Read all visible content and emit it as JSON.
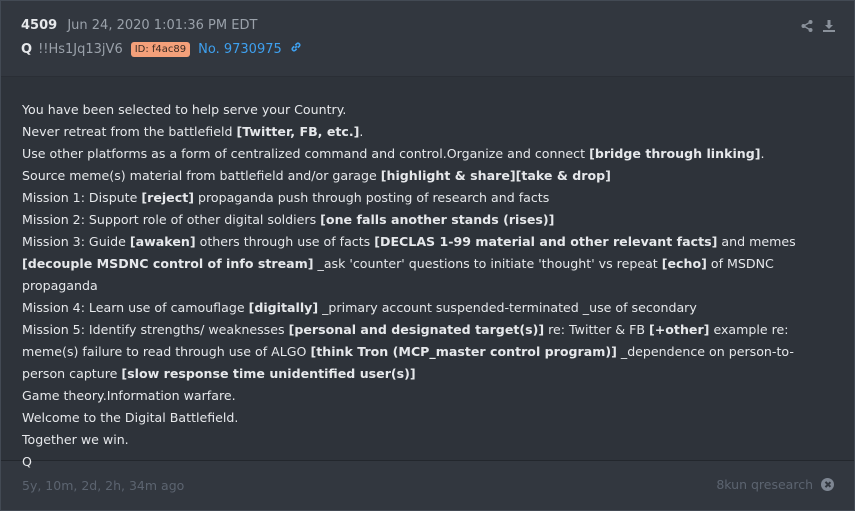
{
  "post": {
    "number": "4509",
    "date": "Jun 24, 2020 1:01:36 PM EDT",
    "author": "Q",
    "tripcode": "!!Hs1Jq13jV6",
    "id_badge": "ID: f4ac89",
    "post_link": "No. 9730975"
  },
  "icons": {
    "share": "share-icon",
    "download": "download-icon",
    "link": "link-icon",
    "close": "close-circle-icon"
  },
  "colors": {
    "background": "#32373f",
    "body_background": "#2e333a",
    "link": "#3ea0ef",
    "id_badge": "#f4a07a"
  },
  "body_lines": [
    [
      {
        "t": "You have been selected to help serve your Country."
      }
    ],
    [
      {
        "t": "Never retreat from the battlefield "
      },
      {
        "t": "[Twitter, FB, etc.]",
        "b": true
      },
      {
        "t": "."
      }
    ],
    [
      {
        "t": "Use other platforms as a form of centralized command and control.Organize and connect "
      },
      {
        "t": "[bridge through linking]",
        "b": true
      },
      {
        "t": "."
      }
    ],
    [
      {
        "t": "Source meme(s) material from battlefield and/or garage "
      },
      {
        "t": "[highlight & share][take & drop]",
        "b": true
      }
    ],
    [
      {
        "t": "Mission 1: Dispute "
      },
      {
        "t": "[reject]",
        "b": true
      },
      {
        "t": " propaganda push through posting of research and facts"
      }
    ],
    [
      {
        "t": "Mission 2: Support role of other digital soldiers "
      },
      {
        "t": "[one falls another stands (rises)]",
        "b": true
      }
    ],
    [
      {
        "t": "Mission 3: Guide "
      },
      {
        "t": "[awaken]",
        "b": true
      },
      {
        "t": " others through use of facts "
      },
      {
        "t": "[DECLAS 1-99 material and other relevant facts]",
        "b": true
      },
      {
        "t": " and memes "
      },
      {
        "t": "[decouple MSDNC control of info stream]",
        "b": true
      },
      {
        "t": " _ask 'counter' questions to initiate 'thought' vs repeat "
      },
      {
        "t": "[echo]",
        "b": true
      },
      {
        "t": " of MSDNC propaganda"
      }
    ],
    [
      {
        "t": "Mission 4: Learn use of camouflage "
      },
      {
        "t": "[digitally]",
        "b": true
      },
      {
        "t": " _primary account suspended-terminated _use of secondary"
      }
    ],
    [
      {
        "t": "Mission 5: Identify strengths/ weaknesses "
      },
      {
        "t": "[personal and designated target(s)]",
        "b": true
      },
      {
        "t": " re: Twitter & FB "
      },
      {
        "t": "[+other]",
        "b": true
      },
      {
        "t": " example re: meme(s) failure to read through use of ALGO "
      },
      {
        "t": "[think Tron (MCP_master control program)]",
        "b": true
      },
      {
        "t": " _dependence on person-to-person capture "
      },
      {
        "t": "[slow response time unidentified user(s)]",
        "b": true
      }
    ],
    [
      {
        "t": "Game theory.Information warfare."
      }
    ],
    [
      {
        "t": "Welcome to the Digital Battlefield."
      }
    ],
    [
      {
        "t": "Together we win."
      }
    ],
    [
      {
        "t": "Q"
      }
    ]
  ],
  "footer": {
    "time_ago": "5y, 10m, 2d, 2h, 34m ago",
    "source": "8kun qresearch"
  }
}
